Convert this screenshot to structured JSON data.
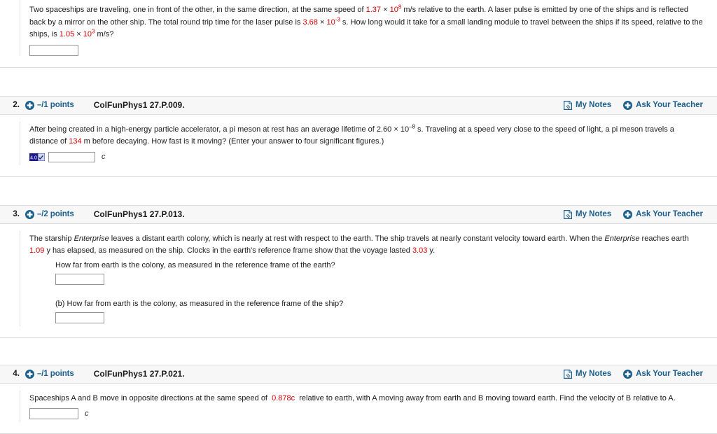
{
  "problems": [
    {
      "number": "",
      "points": "",
      "key": "",
      "partial_top": true,
      "text_html": "Two spaceships are traveling, one in front of the other, in the same direction, at the same speed of <span class=\"num\">1.37</span> × <span class=\"num\">10<sup>8</sup></span> m/s relative to the earth. A laser pulse is emitted by one of the ships and is reflected back by a mirror on the other ship. The total round trip time for the laser pulse is <span class=\"num\">3.68</span> × <span class=\"num\">10<sup>-3</sup></span> s. How long would it take for a small landing module to travel between the ships if its speed, relative to the ships, is <span class=\"num\">1.05</span> × <span class=\"num\">10<sup>3</sup></span> m/s?",
      "answer_value": "",
      "unit": ""
    },
    {
      "number": "2.",
      "points": "–/1 points",
      "key": "ColFunPhys1 27.P.009.",
      "my_notes": "My Notes",
      "ask_teacher": "Ask Your Teacher",
      "text_html": "After being created in a high-energy particle accelerator, a pi meson at rest has an average lifetime of 2.60 × 10<sup>–8</sup> s. Traveling at a speed very close to the speed of light, a pi meson travels a distance of <span class=\"num\">134</span> m before decaying. How fast is it moving? (Enter your answer to four significant figures.)",
      "sigfig_badge": "4.0",
      "answer_value": "",
      "unit": "c"
    },
    {
      "number": "3.",
      "points": "–/2 points",
      "key": "ColFunPhys1 27.P.013.",
      "my_notes": "My Notes",
      "ask_teacher": "Ask Your Teacher",
      "text_html": "The starship <em>Enterprise</em> leaves a distant earth colony, which is nearly at rest with respect to the earth. The ship travels at nearly constant velocity toward earth. When the <em>Enterprise</em> reaches earth <span class=\"num\">1.09</span> y has elapsed, as measured on the ship. Clocks in the earth's reference frame show that the voyage lasted <span class=\"num\">3.03</span> y.",
      "subquestions": [
        {
          "label": "How far from earth is the colony, as measured in the reference frame of the earth?",
          "answer_value": ""
        },
        {
          "label": "(b) How far from earth is the colony, as measured in the reference frame of the ship?",
          "answer_value": ""
        }
      ]
    },
    {
      "number": "4.",
      "points": "–/1 points",
      "key": "ColFunPhys1 27.P.021.",
      "my_notes": "My Notes",
      "ask_teacher": "Ask Your Teacher",
      "text_html": "Spaceships A and B move in opposite directions at the same speed of&nbsp; <span class=\"num\">0.878c</span>&nbsp; relative to earth, with A moving away from earth and B moving toward earth. Find the velocity of B relative to A.",
      "answer_value": "",
      "unit": "c"
    }
  ],
  "icons": {
    "plus": "plus-circle-icon",
    "notes": "notes-page-icon"
  },
  "colors": {
    "link": "#1b5f8c",
    "value_red": "#d40000",
    "header_bg": "#f7f7f7",
    "border": "#dcdcdc"
  }
}
